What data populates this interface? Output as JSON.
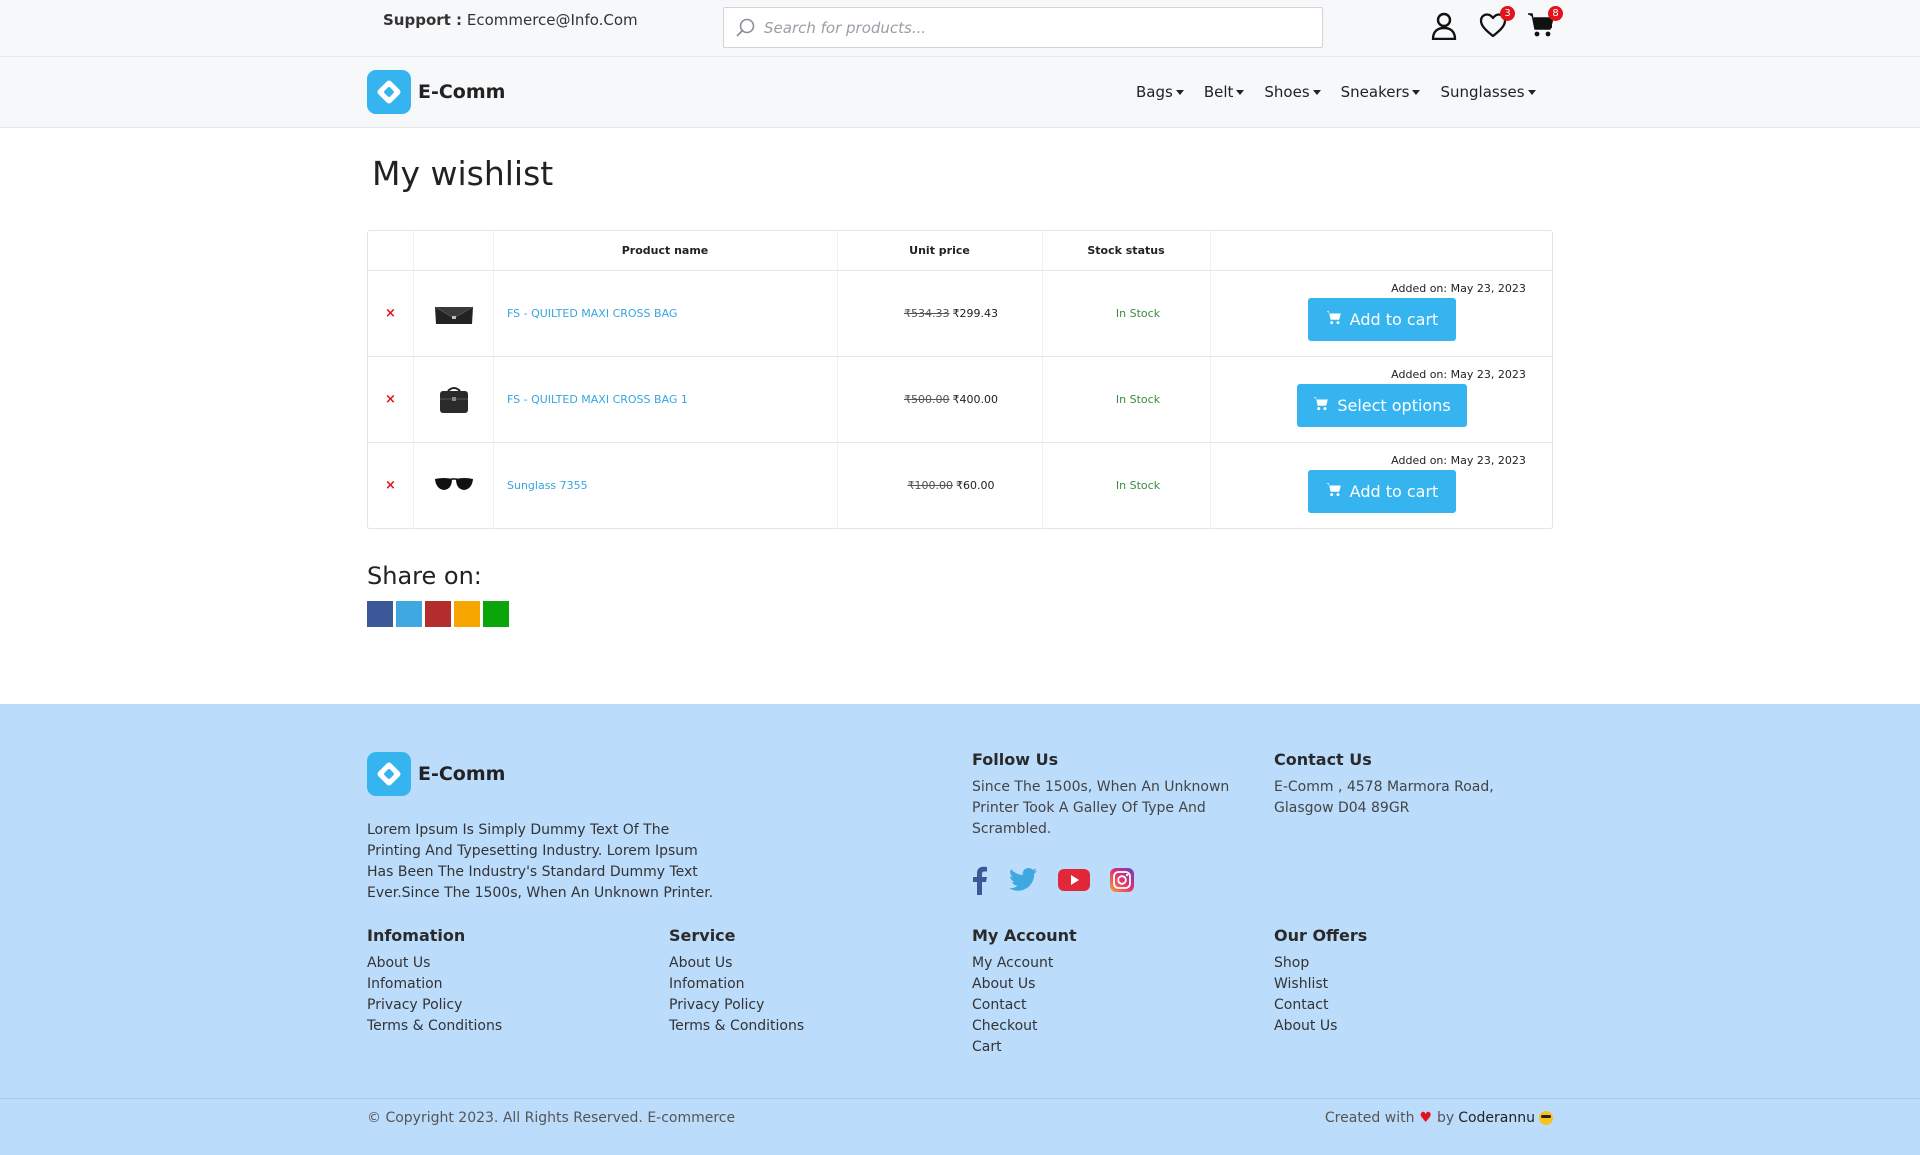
{
  "topbar": {
    "support_label": "Support :",
    "support_email": "Ecommerce@Info.Com",
    "search_placeholder": "Search for products...",
    "wishlist_count": "3",
    "cart_count": "8"
  },
  "brand": {
    "name": "E-Comm",
    "color": "#36b4ef"
  },
  "nav": {
    "items": [
      {
        "label": "Bags"
      },
      {
        "label": "Belt"
      },
      {
        "label": "Shoes"
      },
      {
        "label": "Sneakers"
      },
      {
        "label": "Sunglasses"
      }
    ]
  },
  "main": {
    "title": "My wishlist",
    "table": {
      "headers": {
        "name": "Product name",
        "price": "Unit price",
        "stock": "Stock status"
      },
      "rows": [
        {
          "remove": "×",
          "thumb_icon": "clutch-bag-icon",
          "name": "FS - QUILTED MAXI CROSS BAG",
          "old_price": "₹534.33",
          "price": "₹299.43",
          "stock": "In Stock",
          "added": "Added on: May 23, 2023",
          "action": "Add to cart"
        },
        {
          "remove": "×",
          "thumb_icon": "briefcase-bag-icon",
          "name": "FS - QUILTED MAXI CROSS BAG 1",
          "old_price": "₹500.00",
          "price": "₹400.00",
          "stock": "In Stock",
          "added": "Added on: May 23, 2023",
          "action": "Select options"
        },
        {
          "remove": "×",
          "thumb_icon": "sunglasses-icon",
          "name": "Sunglass 7355",
          "old_price": "₹100.00",
          "price": "₹60.00",
          "stock": "In Stock",
          "added": "Added on: May 23, 2023",
          "action": "Add to cart"
        }
      ]
    },
    "share": {
      "title": "Share on:",
      "colors": [
        "#3b5998",
        "#3fa8e0",
        "#b32d2d",
        "#f7a600",
        "#0aa50a"
      ]
    }
  },
  "footer": {
    "description": "Lorem Ipsum Is Simply Dummy Text Of The Printing And Typesetting Industry. Lorem Ipsum Has Been The Industry's Standard Dummy Text Ever.Since The 1500s, When An Unknown Printer.",
    "follow": {
      "title": "Follow Us",
      "text": "Since The 1500s, When An Unknown Printer Took A Galley Of Type And Scrambled."
    },
    "contact": {
      "title": "Contact Us",
      "text": "E-Comm , 4578 Marmora Road, Glasgow D04 89GR"
    },
    "columns": [
      {
        "title": "Infomation",
        "links": [
          "About Us",
          "Infomation",
          "Privacy Policy",
          "Terms & Conditions"
        ]
      },
      {
        "title": "Service",
        "links": [
          "About Us",
          "Infomation",
          "Privacy Policy",
          "Terms & Conditions"
        ]
      },
      {
        "title": "My Account",
        "links": [
          "My Account",
          "About Us",
          "Contact",
          "Checkout",
          "Cart"
        ]
      },
      {
        "title": "Our Offers",
        "links": [
          "Shop",
          "Wishlist",
          "Contact",
          "About Us"
        ]
      }
    ],
    "copyright": "© Copyright 2023. All Rights Reserved. E-commerce",
    "credit_prefix": "Created with",
    "credit_by": "by",
    "credit_author": "Coderannu",
    "background": "#bcdcfc"
  }
}
